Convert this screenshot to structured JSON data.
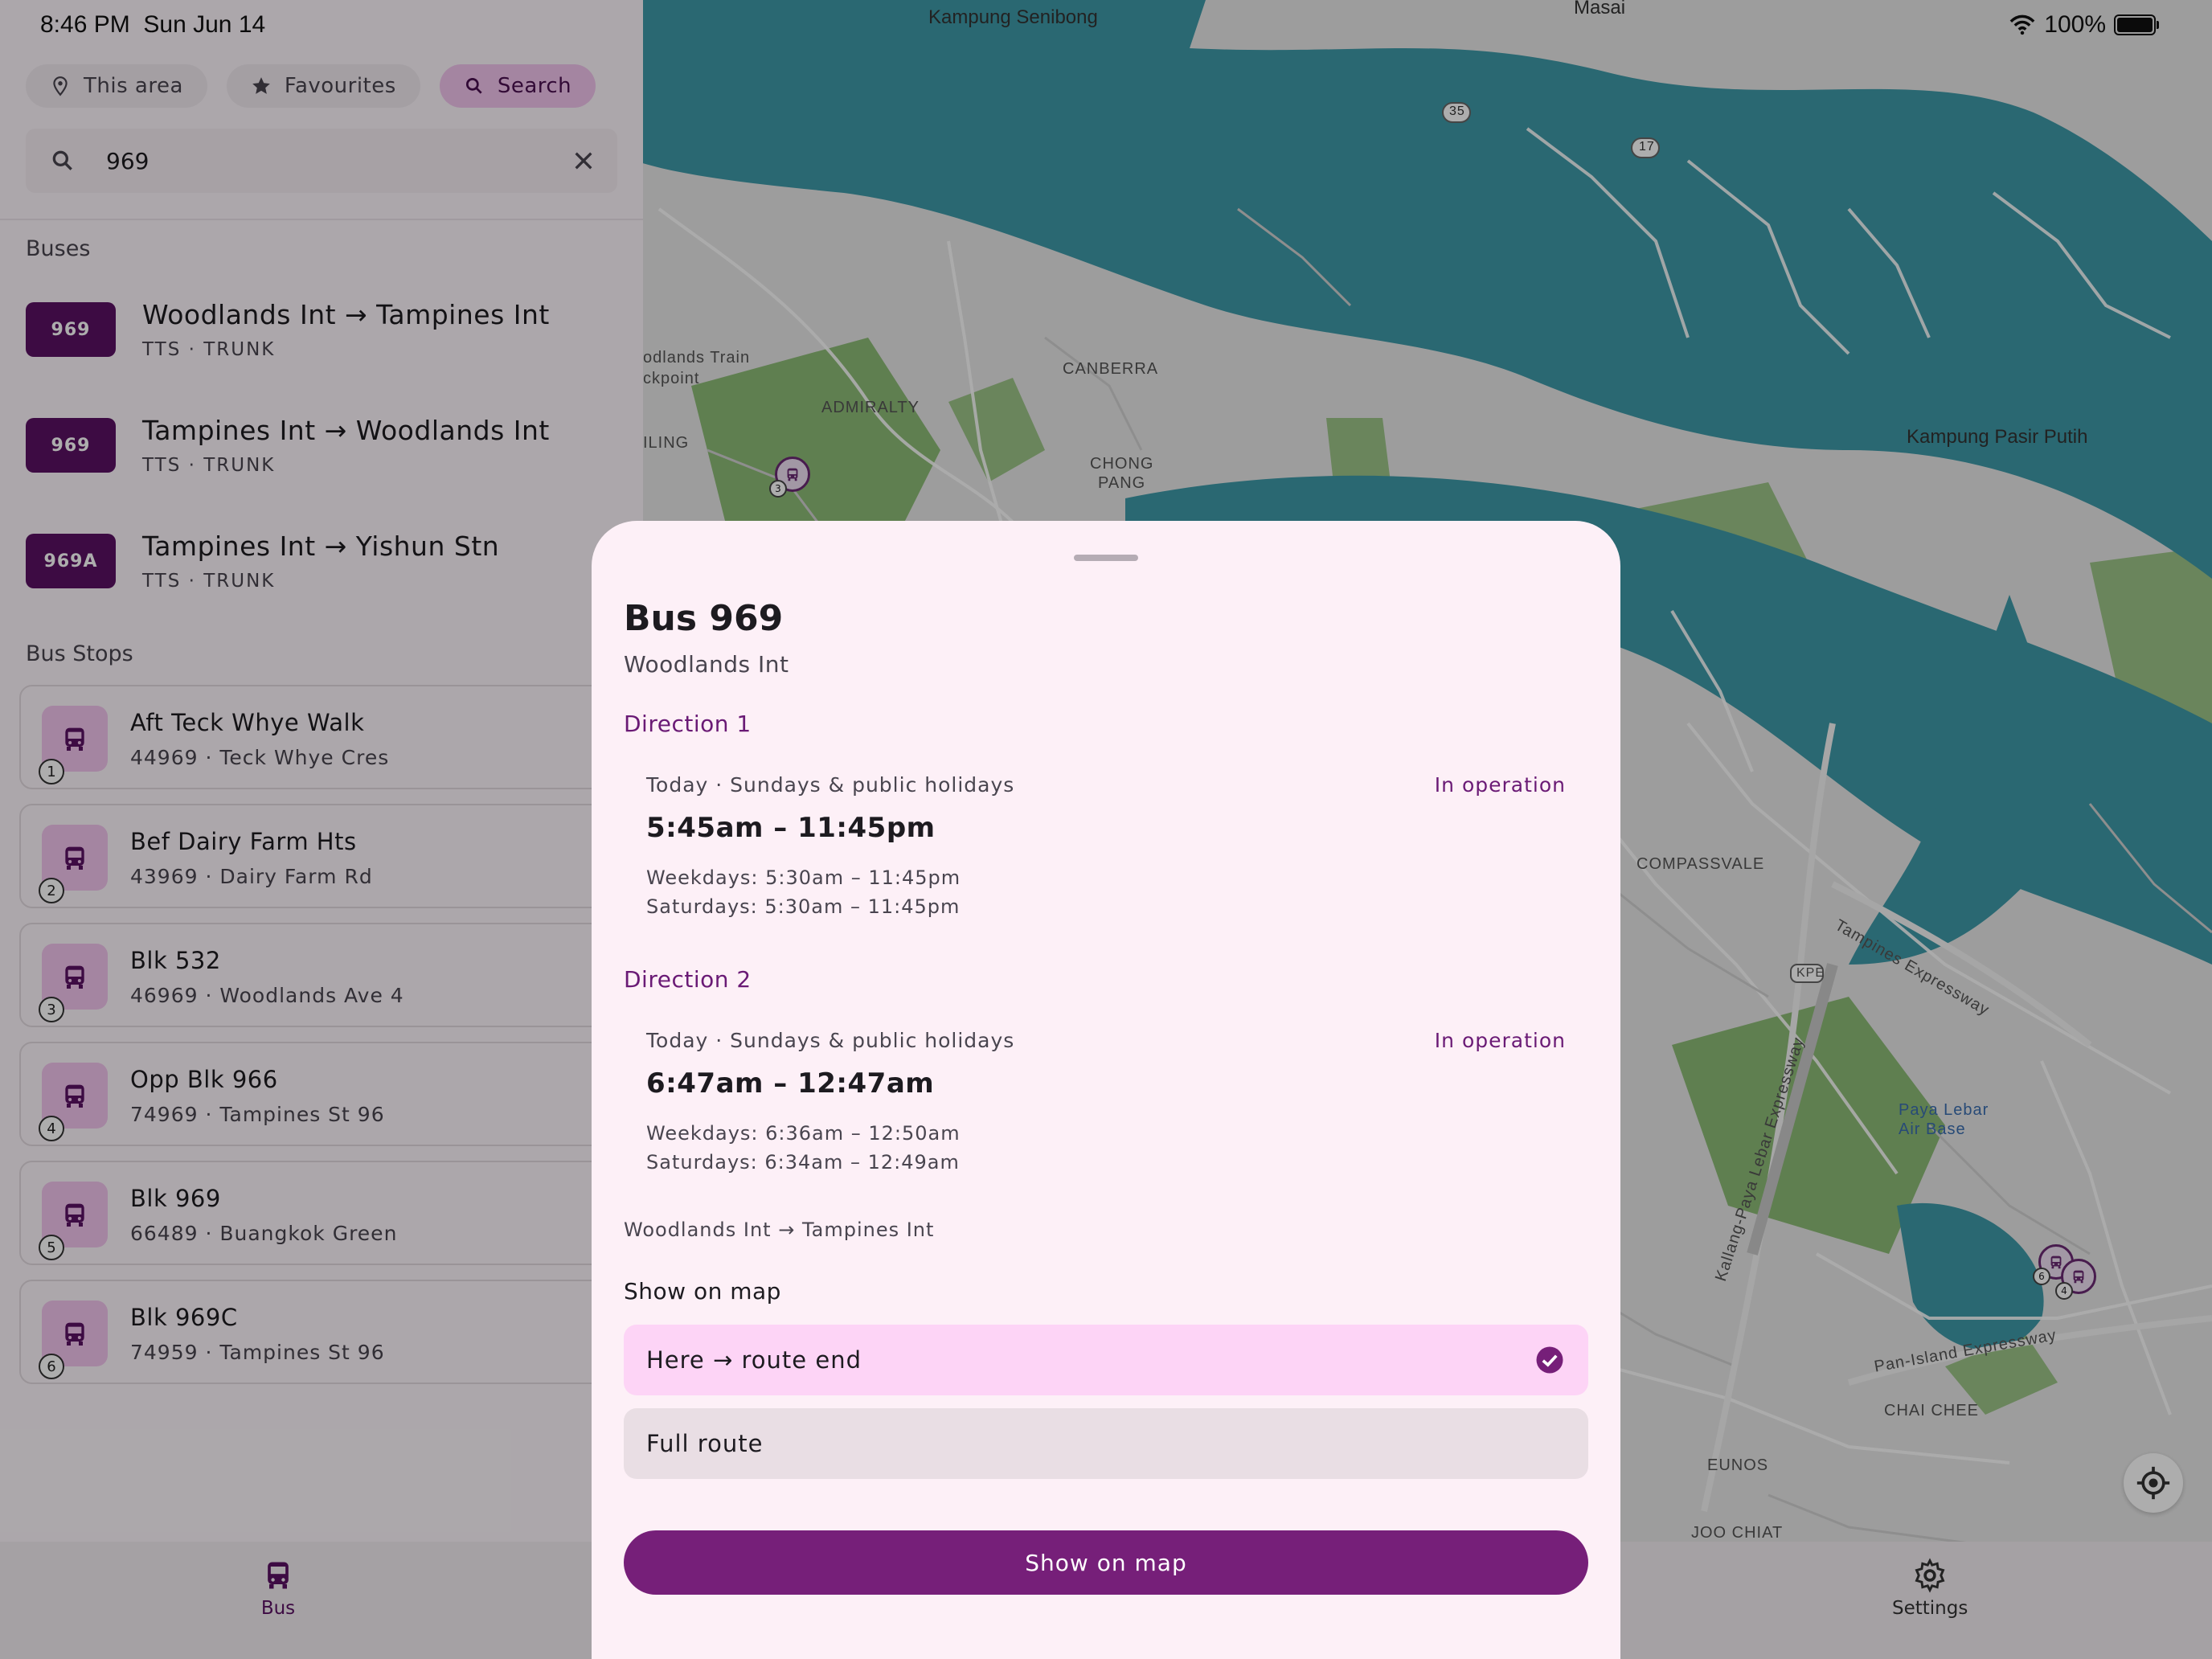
{
  "status_bar": {
    "time": "8:46 PM",
    "date": "Sun Jun 14",
    "battery": "100%"
  },
  "tabs": [
    {
      "label": "This area",
      "icon": "location-pin-icon"
    },
    {
      "label": "Favourites",
      "icon": "star-icon"
    },
    {
      "label": "Search",
      "icon": "search-icon",
      "active": true
    }
  ],
  "search": {
    "value": "969",
    "placeholder": ""
  },
  "buses": {
    "title": "Buses",
    "items": [
      {
        "number": "969",
        "route": "Woodlands Int → Tampines Int",
        "meta": "TTS · TRUNK"
      },
      {
        "number": "969",
        "route": "Tampines Int → Woodlands Int",
        "meta": "TTS · TRUNK"
      },
      {
        "number": "969A",
        "route": "Tampines Int → Yishun Stn",
        "meta": "TTS · TRUNK"
      }
    ]
  },
  "stops": {
    "title": "Bus Stops",
    "items": [
      {
        "num": "1",
        "name": "Aft Teck Whye Walk",
        "meta": "44969 · Teck Whye Cres"
      },
      {
        "num": "2",
        "name": "Bef Dairy Farm Hts",
        "meta": "43969 · Dairy Farm Rd"
      },
      {
        "num": "3",
        "name": "Blk 532",
        "meta": "46969 · Woodlands Ave 4"
      },
      {
        "num": "4",
        "name": "Opp Blk 966",
        "meta": "74969 · Tampines St 96"
      },
      {
        "num": "5",
        "name": "Blk 969",
        "meta": "66489 · Buangkok Green"
      },
      {
        "num": "6",
        "name": "Blk 969C",
        "meta": "74959 · Tampines St 96"
      }
    ]
  },
  "map": {
    "labels": [
      "Kampung Senibong",
      "Masai",
      "odlands Train",
      "ckpoint",
      "ADMIRALTY",
      "CANBERRA",
      "CHONG",
      "PANG",
      "ILING",
      "Kampung Pasir Putih",
      "COMPASSVALE",
      "Tampines Expressway",
      "KPE",
      "Kallang-Paya Lebar Expressway",
      "Paya Lebar",
      "Air Base",
      "Pan-Island Expressway",
      "CHAI CHEE",
      "EUNOS",
      "JOO CHIAT",
      "35",
      "17"
    ],
    "stop_markers": [
      "3",
      "6",
      "4"
    ]
  },
  "nav": {
    "bus": "Bus",
    "settings": "Settings"
  },
  "sheet": {
    "title": "Bus 969",
    "subtitle": "Woodlands Int",
    "directions": [
      {
        "title": "Direction 1",
        "today": "Today · Sundays & public holidays",
        "status": "In operation",
        "hours": "5:45am – 11:45pm",
        "weekdays": "Weekdays: 5:30am – 11:45pm",
        "saturdays": "Saturdays: 5:30am – 11:45pm"
      },
      {
        "title": "Direction 2",
        "today": "Today · Sundays & public holidays",
        "status": "In operation",
        "hours": "6:47am – 12:47am",
        "weekdays": "Weekdays: 6:36am – 12:50am",
        "saturdays": "Saturdays: 6:34am – 12:49am"
      }
    ],
    "route_note": "Woodlands Int → Tampines Int",
    "show_on_map_title": "Show on map",
    "options": [
      {
        "label": "Here → route end",
        "selected": true
      },
      {
        "label": "Full route",
        "selected": false
      }
    ],
    "button": "Show on map"
  },
  "colors": {
    "accent": "#761f79",
    "badge": "#5b1163",
    "water": "#3f9aa8",
    "land": "#e7e7e7",
    "park": "#7fb56a"
  }
}
